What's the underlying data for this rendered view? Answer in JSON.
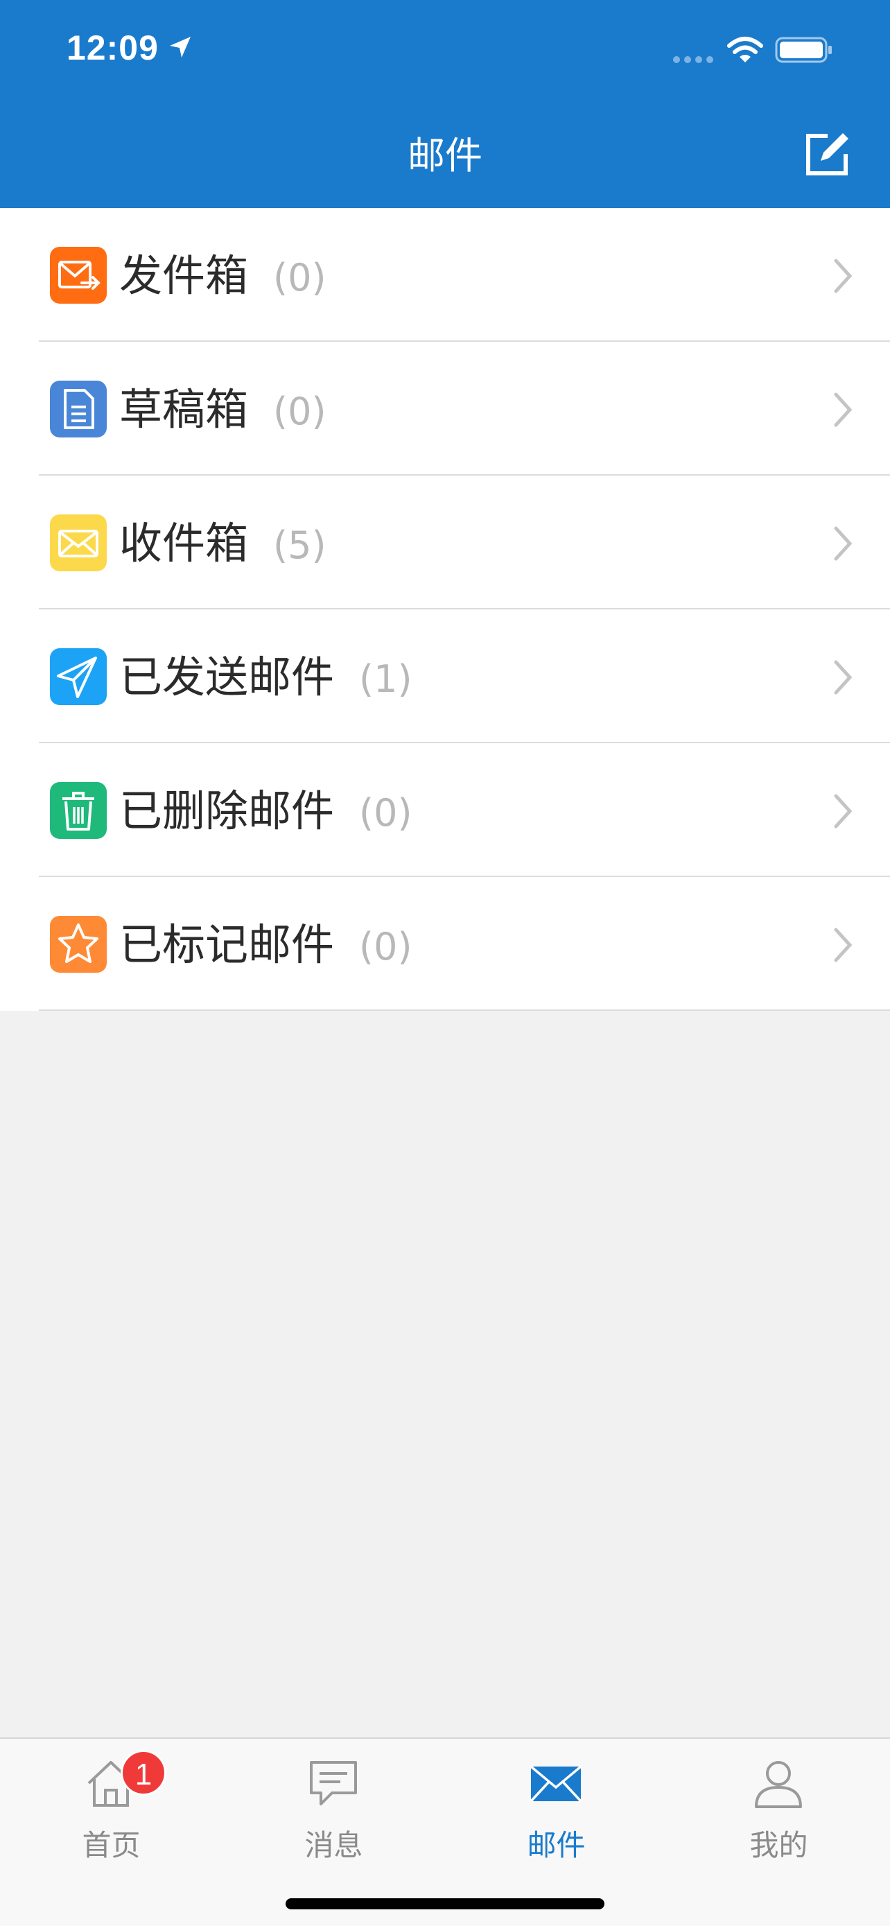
{
  "status_bar": {
    "time": "12:09"
  },
  "header": {
    "title": "邮件"
  },
  "mail_folders": [
    {
      "label": "发件箱",
      "count": "(0)",
      "icon": "outbox-icon",
      "color": "#ff6c12"
    },
    {
      "label": "草稿箱",
      "count": "(0)",
      "icon": "draft-document-icon",
      "color": "#4a86d8"
    },
    {
      "label": "收件箱",
      "count": "(5)",
      "icon": "inbox-envelope-icon",
      "color": "#fcd94a"
    },
    {
      "label": "已发送邮件",
      "count": "(1)",
      "icon": "paper-plane-icon",
      "color": "#1ca3f5"
    },
    {
      "label": "已删除邮件",
      "count": "(0)",
      "icon": "trash-icon",
      "color": "#1fb97b"
    },
    {
      "label": "已标记邮件",
      "count": "(0)",
      "icon": "star-icon",
      "color": "#ff8a36"
    }
  ],
  "tabbar": {
    "tabs": [
      {
        "label": "首页",
        "icon": "home-icon",
        "badge": "1"
      },
      {
        "label": "消息",
        "icon": "message-icon"
      },
      {
        "label": "邮件",
        "icon": "mail-icon",
        "active": true
      },
      {
        "label": "我的",
        "icon": "user-icon"
      }
    ]
  },
  "colors": {
    "primary": "#1a7bcd",
    "background": "#f1f1f1",
    "badge": "#f03a3a"
  }
}
